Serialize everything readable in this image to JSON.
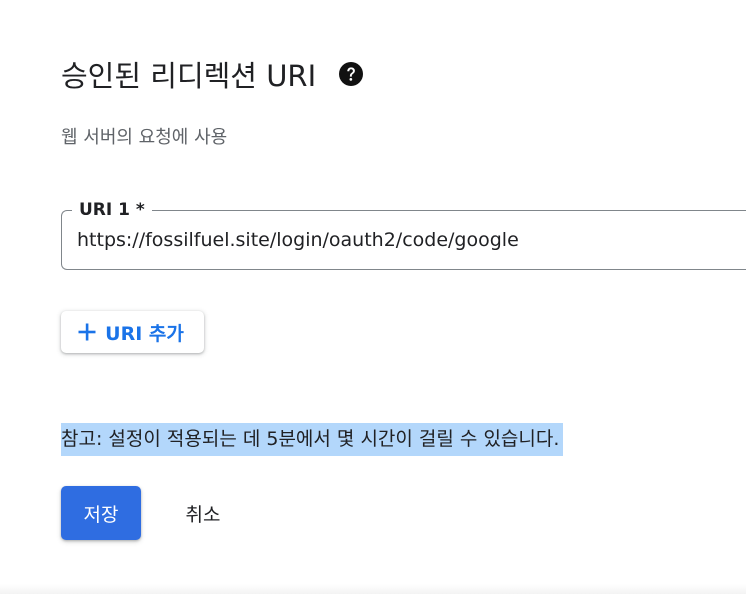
{
  "section": {
    "title": "승인된 리디렉션 URI",
    "help_icon": "help-circle-icon",
    "subtitle": "웹 서버의 요청에 사용"
  },
  "uri_field": {
    "label": "URI 1 *",
    "value": "https://fossilfuel.site/login/oauth2/code/google"
  },
  "add_uri_button": {
    "icon": "plus-icon",
    "label": "URI 추가"
  },
  "note": {
    "text": "참고: 설정이 적용되는 데 5분에서 몇 시간이 걸릴 수 있습니다."
  },
  "actions": {
    "save_label": "저장",
    "cancel_label": "취소"
  },
  "colors": {
    "accent": "#1a73e8",
    "primary_button": "#2f6de1",
    "selection_highlight": "#b3d7fb"
  }
}
